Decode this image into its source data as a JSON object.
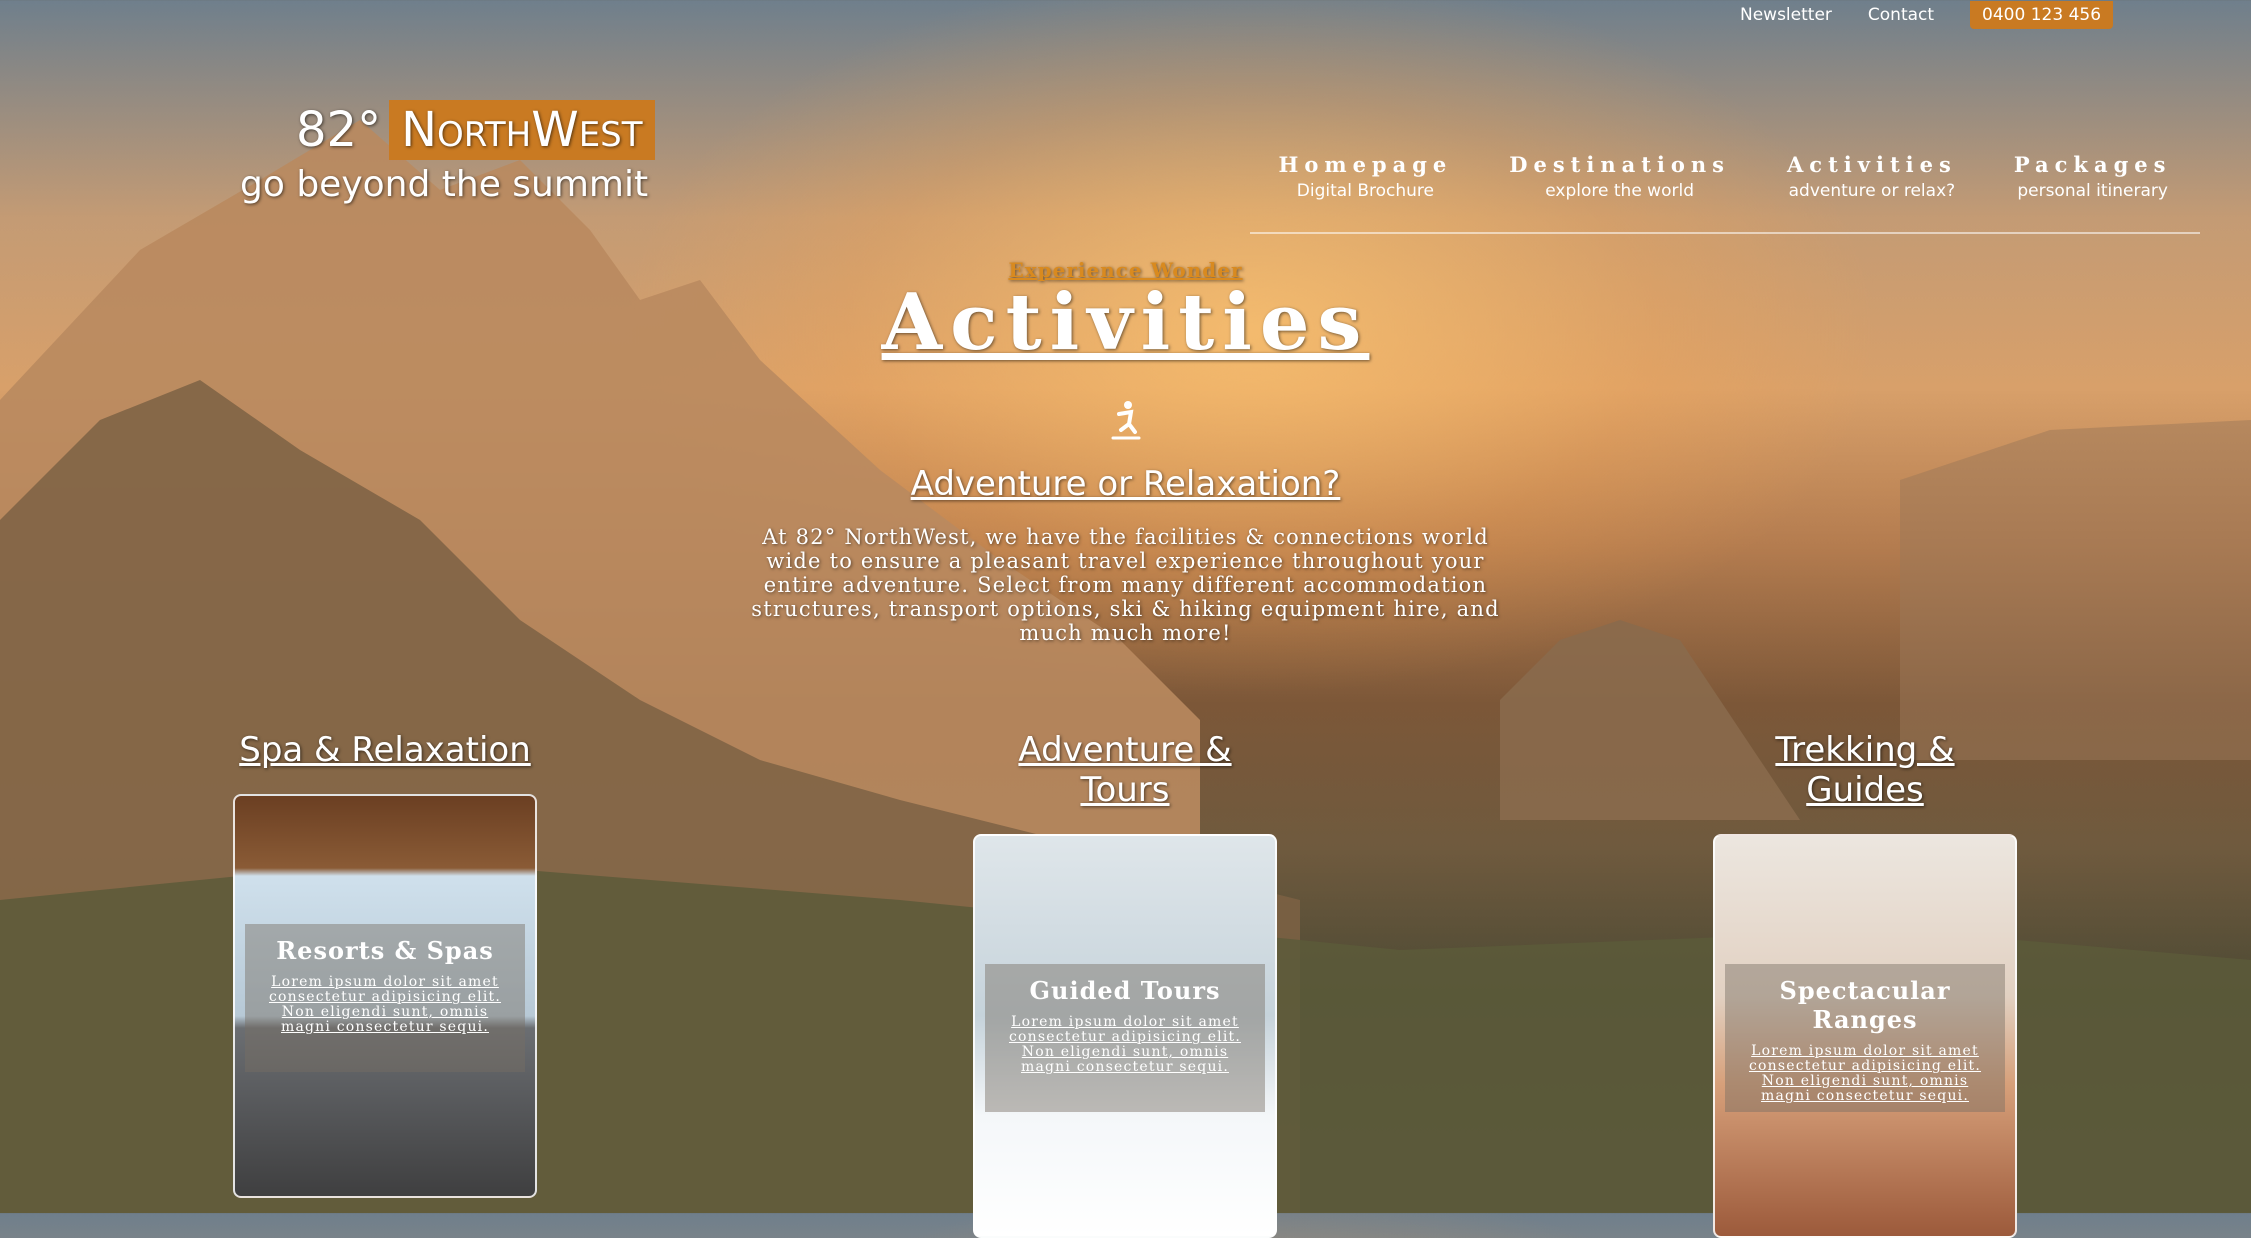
{
  "topbar": {
    "newsletter": "Newsletter",
    "contact": "Contact",
    "phone": "0400 123 456"
  },
  "logo": {
    "degree": "82°",
    "brand": "NorthWest",
    "tagline": "go beyond the summit"
  },
  "nav": [
    {
      "label": "Homepage",
      "sub": "Digital Brochure"
    },
    {
      "label": "Destinations",
      "sub": "explore the world"
    },
    {
      "label": "Activities",
      "sub": "adventure or relax?"
    },
    {
      "label": "Packages",
      "sub": "personal itinerary"
    }
  ],
  "hero": {
    "eyebrow": "Experience Wonder",
    "title": "Activities",
    "icon": "skier-icon",
    "question": "Adventure or Relaxation?",
    "body": "At 82° NorthWest, we have the facilities & connections world wide to ensure a pleasant travel experience throughout your entire adventure. Select from many different accommodation structures, transport options, ski & hiking equipment hire, and much much more!"
  },
  "columns": [
    {
      "title": "Spa & Relaxation",
      "card_title": "Resorts & Spas",
      "card_text": "Lorem ipsum dolor sit amet consectetur adipisicing elit. Non eligendi sunt, omnis magni consectetur sequi."
    },
    {
      "title": "Adventure & Tours",
      "card_title": "Guided Tours",
      "card_text": "Lorem ipsum dolor sit amet consectetur adipisicing elit. Non eligendi sunt, omnis magni consectetur sequi."
    },
    {
      "title": "Trekking & Guides",
      "card_title": "Spectacular Ranges",
      "card_text": "Lorem ipsum dolor sit amet consectetur adipisicing elit. Non eligendi sunt, omnis magni consectetur sequi."
    }
  ],
  "colors": {
    "accent": "#c97a22",
    "eyebrow": "#d98a1f"
  }
}
